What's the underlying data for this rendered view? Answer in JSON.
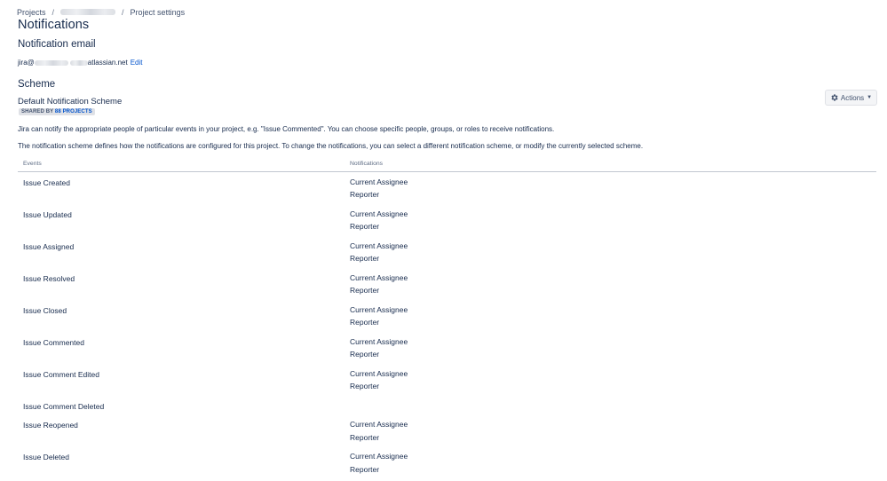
{
  "breadcrumb": {
    "projects": "Projects",
    "project_settings": "Project settings"
  },
  "page_title": "Notifications",
  "email_section": {
    "heading": "Notification email",
    "email_prefix": "jira@",
    "email_suffix": "atlassian.net",
    "edit_label": "Edit"
  },
  "scheme_section": {
    "heading": "Scheme",
    "scheme_name": "Default Notification Scheme",
    "shared_by_label": "SHARED BY",
    "shared_projects_link": "88 PROJECTS",
    "actions_label": "Actions",
    "description_1": "Jira can notify the appropriate people of particular events in your project, e.g. \"Issue Commented\". You can choose specific people, groups, or roles to receive notifications.",
    "description_2": "The notification scheme defines how the notifications are configured for this project. To change the notifications, you can select a different notification scheme, or modify the currently selected scheme."
  },
  "table": {
    "headers": {
      "events": "Events",
      "notifications": "Notifications"
    },
    "rows": [
      {
        "event": "Issue Created",
        "notifications": [
          "Current Assignee",
          "Reporter"
        ]
      },
      {
        "event": "Issue Updated",
        "notifications": [
          "Current Assignee",
          "Reporter"
        ]
      },
      {
        "event": "Issue Assigned",
        "notifications": [
          "Current Assignee",
          "Reporter"
        ]
      },
      {
        "event": "Issue Resolved",
        "notifications": [
          "Current Assignee",
          "Reporter"
        ]
      },
      {
        "event": "Issue Closed",
        "notifications": [
          "Current Assignee",
          "Reporter"
        ]
      },
      {
        "event": "Issue Commented",
        "notifications": [
          "Current Assignee",
          "Reporter"
        ]
      },
      {
        "event": "Issue Comment Edited",
        "notifications": [
          "Current Assignee",
          "Reporter"
        ]
      },
      {
        "event": "Issue Comment Deleted",
        "notifications": []
      },
      {
        "event": "Issue Reopened",
        "notifications": [
          "Current Assignee",
          "Reporter"
        ]
      },
      {
        "event": "Issue Deleted",
        "notifications": [
          "Current Assignee",
          "Reporter"
        ]
      }
    ]
  },
  "icons": {
    "actions": "gear-icon",
    "dropdown": "chevron-down-icon"
  },
  "colors": {
    "link": "#0052cc",
    "text": "#172b4d",
    "muted": "#5e6c84",
    "lozenge_bg": "#dfe1e6"
  }
}
